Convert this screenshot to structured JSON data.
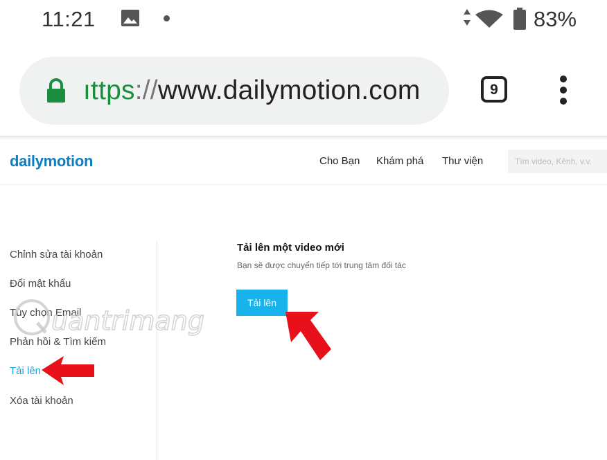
{
  "status_bar": {
    "time": "11:21",
    "battery": "83%",
    "icons": [
      "image-icon",
      "notification-dot-icon",
      "data-arrows-icon",
      "wifi-icon",
      "battery-icon"
    ]
  },
  "browser": {
    "url_scheme": "ıttps",
    "url_separator": "://",
    "url_host": "www.dailymotion.com",
    "tab_count": "9",
    "icons": [
      "lock-icon",
      "overflow-menu-icon"
    ]
  },
  "site": {
    "logo": "dailymotion",
    "nav": [
      "Cho Bạn",
      "Khám phá",
      "Thư viện"
    ],
    "search_placeholder": "Tìm video, Kênh, v.v.",
    "brand_color": "#0d7ec3",
    "accent_color": "#19b3eb"
  },
  "sidebar": {
    "items": [
      {
        "label": "Chỉnh sửa tài khoản",
        "active": false
      },
      {
        "label": "Đổi mật khẩu",
        "active": false
      },
      {
        "label": "Tùy chọn Email",
        "active": false
      },
      {
        "label": "Phản hồi & Tìm kiếm",
        "active": false
      },
      {
        "label": "Tải lên",
        "active": true
      },
      {
        "label": "Xóa tài khoản",
        "active": false
      }
    ]
  },
  "main": {
    "title": "Tải lên một video mới",
    "subtitle": "Bạn sẽ được chuyển tiếp tới trung tâm đối tác",
    "upload_button": "Tải lên"
  },
  "annotations": {
    "arrow_color": "#e8101a",
    "watermark": "uantrimang"
  }
}
